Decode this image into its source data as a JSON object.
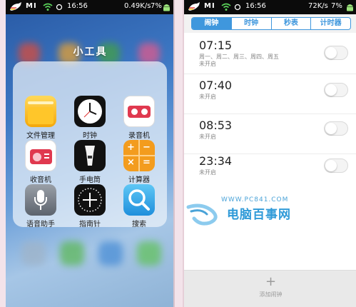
{
  "left_phone": {
    "status": {
      "brand": "MI",
      "time": "16:56",
      "speed": "0.49K/s",
      "battery": "7%",
      "battery_level": 0.07
    },
    "folder": {
      "title": "小工具",
      "apps": [
        {
          "label": "文件管理",
          "icon": "folder-icon"
        },
        {
          "label": "时钟",
          "icon": "clock-icon"
        },
        {
          "label": "录音机",
          "icon": "recorder-icon"
        },
        {
          "label": "收音机",
          "icon": "radio-icon"
        },
        {
          "label": "手电筒",
          "icon": "flashlight-icon"
        },
        {
          "label": "计算器",
          "icon": "calculator-icon"
        },
        {
          "label": "语音助手",
          "icon": "microphone-icon"
        },
        {
          "label": "指南针",
          "icon": "compass-icon"
        },
        {
          "label": "搜索",
          "icon": "search-icon"
        }
      ]
    }
  },
  "right_phone": {
    "status": {
      "brand": "MI",
      "time": "16:56",
      "speed": "72K/s",
      "battery": "7%",
      "battery_level": 0.07
    },
    "tabs": [
      {
        "label": "闹钟",
        "active": true
      },
      {
        "label": "时钟",
        "active": false
      },
      {
        "label": "秒表",
        "active": false
      },
      {
        "label": "计时器",
        "active": false
      }
    ],
    "alarms": [
      {
        "time": "07:15",
        "days": "周一、周二、周三、周四、周五",
        "status": "未开启",
        "enabled": false
      },
      {
        "time": "07:40",
        "days": "",
        "status": "未开启",
        "enabled": false
      },
      {
        "time": "08:53",
        "days": "",
        "status": "未开启",
        "enabled": false
      },
      {
        "time": "23:34",
        "days": "",
        "status": "未开启",
        "enabled": false
      }
    ],
    "watermark": {
      "url": "WWW.PC841.COM",
      "name": "电脑百事网"
    },
    "add_button": {
      "icon": "plus-icon",
      "label": "添加闹钟"
    }
  },
  "colors": {
    "accent": "#3f97dd",
    "status_bar": "#0b0b0b",
    "watermark": "#2f9ad8"
  }
}
